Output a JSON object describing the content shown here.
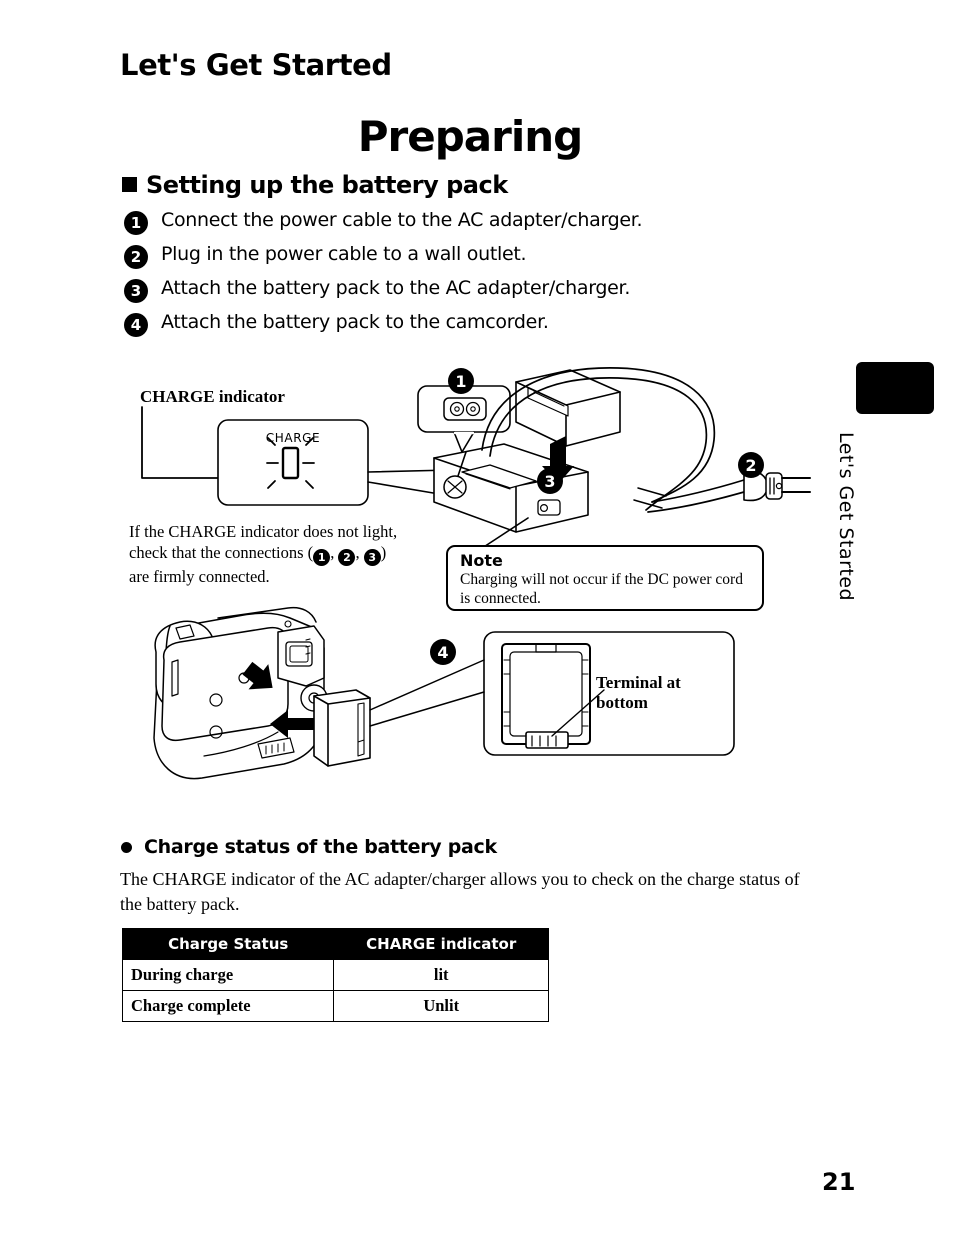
{
  "chapter_title": "Let's Get Started",
  "main_title": "Preparing",
  "section_title": "Setting up the battery pack",
  "steps": [
    {
      "num": "1",
      "text": "Connect the power cable to the AC adapter/charger."
    },
    {
      "num": "2",
      "text": "Plug in the power cable to a wall outlet."
    },
    {
      "num": "3",
      "text": "Attach the battery pack to the AC adapter/charger."
    },
    {
      "num": "4",
      "text": "Attach the battery pack to the camcorder."
    }
  ],
  "diagram": {
    "charge_indicator_label": "CHARGE indicator",
    "charge_led_text": "CHARGE",
    "charge_note_line1": "If the CHARGE indicator does not light,",
    "charge_note_line2_pre": "check that the connections (",
    "charge_note_line2_post": ")",
    "charge_note_line3": "are firmly connected.",
    "charge_note_refs": [
      "1",
      "2",
      "3"
    ],
    "callout_markers": [
      "1",
      "2",
      "3",
      "4"
    ],
    "note_title": "Note",
    "note_body": "Charging will not occur if the DC power cord is connected.",
    "terminal_label_line1": "Terminal at",
    "terminal_label_line2": "bottom"
  },
  "charge_status": {
    "heading": "Charge status of the battery pack",
    "body": "The CHARGE indicator of the AC adapter/charger allows you to check on the charge status of the battery pack.",
    "table": {
      "headers": [
        "Charge Status",
        "CHARGE indicator"
      ],
      "rows": [
        [
          "During charge",
          "lit"
        ],
        [
          "Charge complete",
          "Unlit"
        ]
      ]
    }
  },
  "side_tab": {
    "text": "Let's Get Started"
  },
  "page_number": "21"
}
